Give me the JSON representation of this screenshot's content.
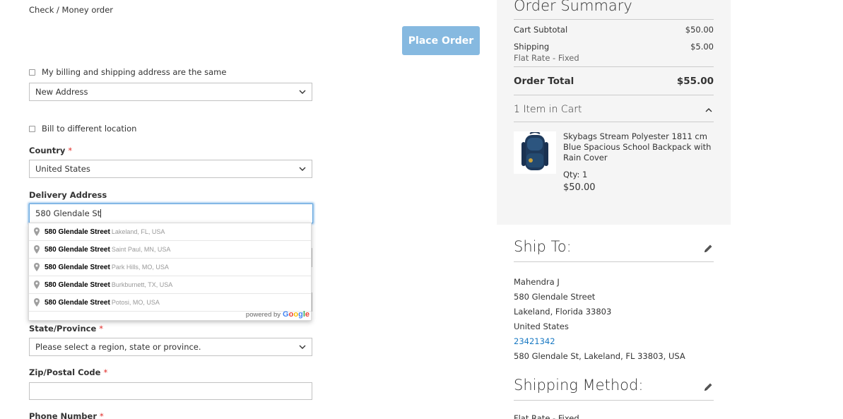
{
  "payment": {
    "method_label": "Check / Money order",
    "place_order_label": "Place Order"
  },
  "billing": {
    "same_address_label": "My billing and shipping address are the same",
    "address_select_value": "New Address",
    "bill_different_label": "Bill to different location"
  },
  "form": {
    "country_label": "Country",
    "country_value": "United States",
    "delivery_label": "Delivery Address",
    "delivery_value": "580 Glendale St",
    "state_label": "State/Province",
    "state_value": "Please select a region, state or province.",
    "zip_label": "Zip/Postal Code",
    "zip_value": "",
    "phone_label": "Phone Number",
    "required_mark": "*"
  },
  "autocomplete": {
    "suggestions": [
      {
        "main": "580 Glendale Street",
        "secondary": "Lakeland, FL, USA"
      },
      {
        "main": "580 Glendale Street",
        "secondary": "Saint Paul, MN, USA"
      },
      {
        "main": "580 Glendale Street",
        "secondary": "Park Hills, MO, USA"
      },
      {
        "main": "580 Glendale Street",
        "secondary": "Burkburnett, TX, USA"
      },
      {
        "main": "580 Glendale Street",
        "secondary": "Potosi, MO, USA"
      }
    ],
    "powered_by": "powered by",
    "google_letters": [
      "G",
      "o",
      "o",
      "g",
      "l",
      "e"
    ],
    "google_colors": [
      "#4285f4",
      "#ea4335",
      "#fbbc05",
      "#4285f4",
      "#34a853",
      "#ea4335"
    ]
  },
  "summary": {
    "title": "Order Summary",
    "subtotal_label": "Cart Subtotal",
    "subtotal_value": "$50.00",
    "shipping_label": "Shipping",
    "shipping_value": "$5.00",
    "shipping_method": "Flat Rate - Fixed",
    "total_label": "Order Total",
    "total_value": "$55.00",
    "items_label": "1 Item in Cart",
    "product_name": "Skybags Stream Polyester 1811 cm Blue Spacious School Backpack with Rain Cover",
    "product_qty": "Qty: 1",
    "product_price": "$50.00"
  },
  "ship_to": {
    "title": "Ship To:",
    "name": "Mahendra J",
    "street": "580 Glendale Street",
    "city_line": "Lakeland, Florida 33803",
    "country": "United States",
    "phone": "23421342",
    "full_address": "580 Glendale St, Lakeland, FL 33803, USA"
  },
  "shipping_method": {
    "title": "Shipping Method:",
    "value": "Flat Rate - Fixed"
  },
  "colors": {
    "accent_button": "#86b9e0",
    "required": "#e02b27",
    "link": "#1979c3",
    "summary_bg": "#f5f5f5"
  },
  "icons": [
    "chevron-down-icon",
    "chevron-up-icon",
    "map-pin-icon",
    "pencil-icon",
    "backpack-image"
  ]
}
